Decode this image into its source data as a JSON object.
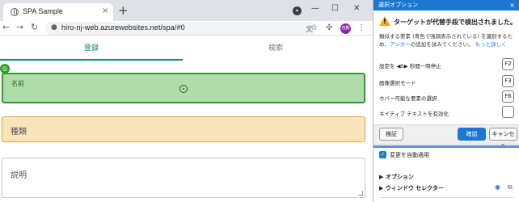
{
  "browser": {
    "tab_title": "SPA Sample",
    "tab_close": "×",
    "new_tab": "+",
    "profile_badge": "▾",
    "minimize": "—",
    "maximize": "☐",
    "window_close": "✕",
    "back": "←",
    "forward": "→",
    "reload": "↻",
    "lock": "🔒",
    "url": "hiro-nj-web.azurewebsites.net/spa/#0",
    "translate_icon": "文",
    "bookmark_icon": "☆",
    "extensions_icon": "✣",
    "avatar_initials": "自動",
    "menu_icon": "⋮"
  },
  "page": {
    "tabs": [
      {
        "label": "登録",
        "active": true
      },
      {
        "label": "検索",
        "active": false
      }
    ],
    "fields": {
      "name_label": "名前",
      "kind_label": "種類",
      "description_label": "説明"
    },
    "picker_badge": "◎"
  },
  "panel": {
    "header": "選択オプション",
    "close": "×",
    "warning_title": "ターゲットが代替手段で検出されました。",
    "warning_body_1": "類似する要素 (青色で強調表示されている) を識別するため、",
    "warning_link": "アンカー",
    "warning_body_2": "の追加を試みてください。",
    "more_link": "もっと詳しく",
    "options": [
      {
        "label": "設定を ◀5▶ 秒間一時停止",
        "key": "F2"
      },
      {
        "label": "画像選択モード",
        "key": "F3"
      },
      {
        "label": "ホバー可能な要素の選択",
        "key": "F6"
      },
      {
        "label": "ネイティブ テキストを有効化",
        "key": ""
      }
    ],
    "buttons": {
      "validate": "検証",
      "confirm": "確認",
      "cancel": "キャンセル"
    },
    "auto_apply": "変更を自動適用",
    "auto_apply_check": "✓",
    "sections": {
      "options": "▶ オプション",
      "window_selector": "▶ ウィンドウ セレクター"
    }
  },
  "colors": {
    "accent_blue": "#1e76d3",
    "tab_green": "#1a8a6a",
    "name_field_bg": "#b0dcaa",
    "kind_field_bg": "#fae4b9"
  }
}
